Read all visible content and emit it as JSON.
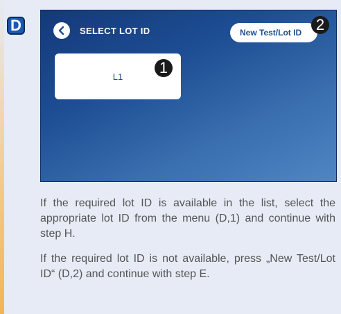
{
  "step_letter": "D",
  "screen": {
    "title": "SELECT LOT ID",
    "new_button_label": "New Test/Lot ID",
    "lots": [
      {
        "label": "L1"
      }
    ]
  },
  "callouts": {
    "lot_tile": "1",
    "new_button": "2"
  },
  "instructions": [
    "If the required lot ID is available in the list, select the appropriate lot ID from the menu (D,1) and continue with step H.",
    "If the required lot ID is not available, press „New Test/Lot ID“ (D,2) and continue with step E."
  ],
  "colors": {
    "screen_blue": "#1d4d93",
    "step_badge": "#1a5ab4",
    "callout": "#1a1a1a"
  }
}
